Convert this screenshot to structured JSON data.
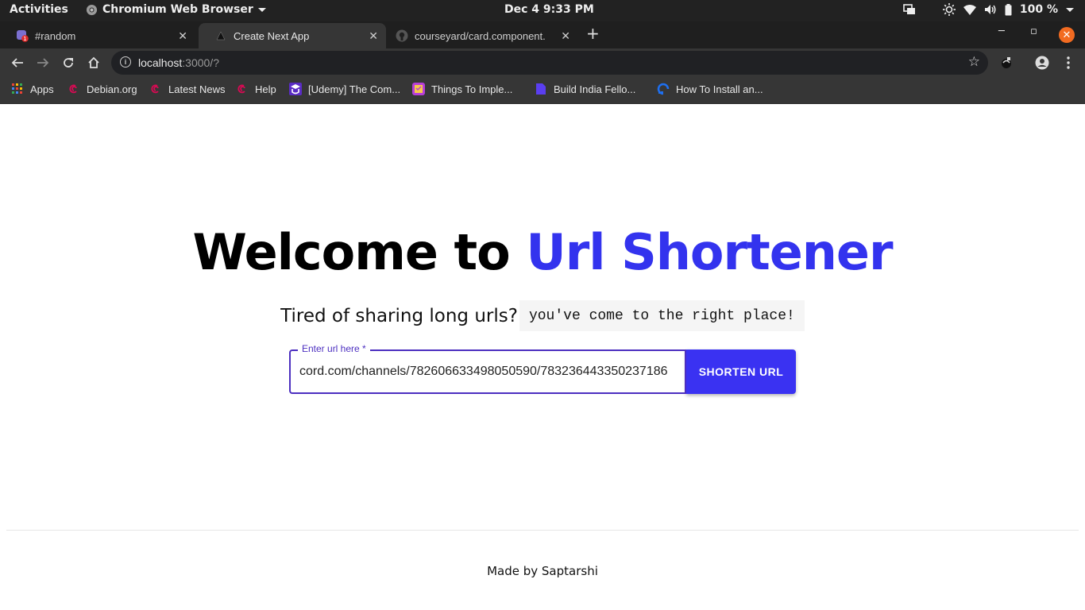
{
  "system": {
    "activities": "Activities",
    "app_menu": "Chromium Web Browser",
    "clock": "Dec 4   9:33 PM",
    "battery": "100 %"
  },
  "tabs": [
    {
      "title": "#random",
      "badge": "1",
      "active": false
    },
    {
      "title": "Create Next App",
      "active": true
    },
    {
      "title": "courseyard/card.component.",
      "active": false
    }
  ],
  "address": {
    "host": "localhost",
    "rest": ":3000/?"
  },
  "bookmarks": [
    {
      "label": "Apps",
      "icon": "apps-grid-icon"
    },
    {
      "label": "Debian.org",
      "icon": "debian-icon"
    },
    {
      "label": "Latest News",
      "icon": "debian-icon"
    },
    {
      "label": "Help",
      "icon": "debian-icon"
    },
    {
      "label": "[Udemy] The Com...",
      "icon": "udemy-icon"
    },
    {
      "label": "Things To Imple...",
      "icon": "notes-icon"
    },
    {
      "label": "Build India Fello...",
      "icon": "doc-icon"
    },
    {
      "label": "How To Install an...",
      "icon": "digitalocean-icon"
    }
  ],
  "hero": {
    "title_plain": "Welcome to ",
    "title_accent": "Url Shortener",
    "accent_color": "#3333ee",
    "tagline": "Tired of sharing long urls?",
    "tagline_code": "you've come to the right place!"
  },
  "form": {
    "label": "Enter url here *",
    "value": "cord.com/channels/782606633498050590/783236443350237186",
    "button": "SHORTEN URL",
    "button_color": "#3a32f2"
  },
  "footer": {
    "text": "Made by Saptarshi"
  }
}
